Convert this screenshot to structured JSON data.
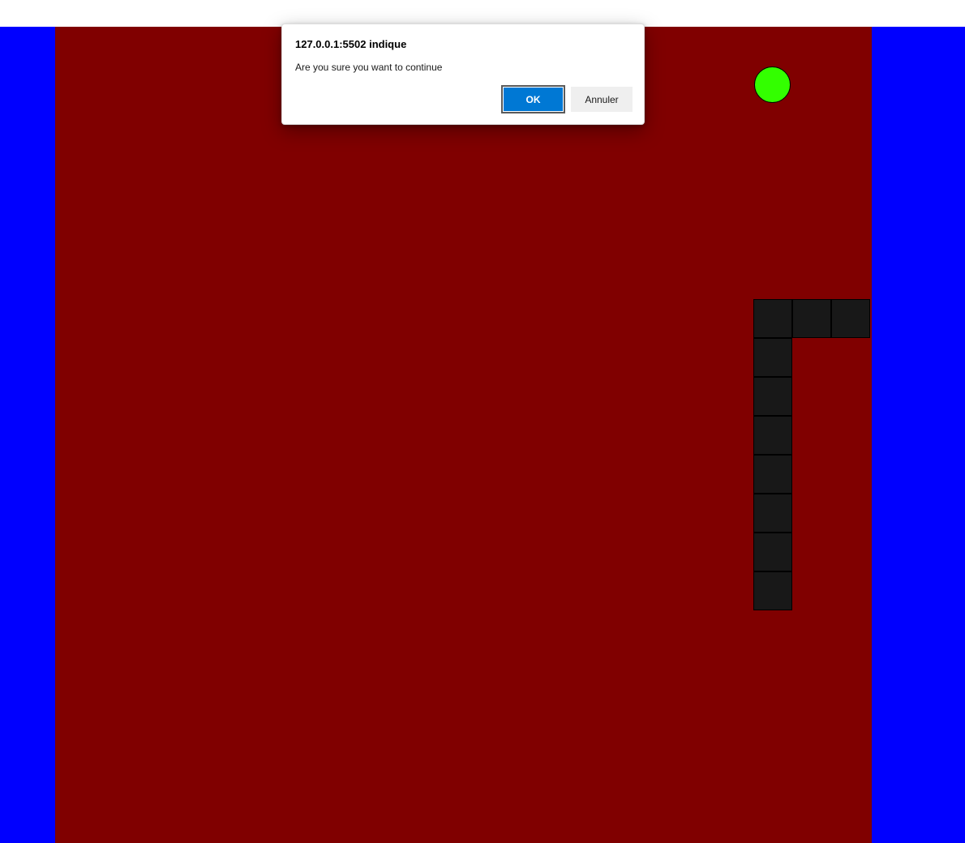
{
  "colors": {
    "page_background": "#0000ff",
    "board_background": "#800000",
    "snake": "#181818",
    "food": "#33ff00",
    "ok_button": "#0078d4"
  },
  "game": {
    "snake_segments": 10,
    "food_count": 1
  },
  "dialog": {
    "title": "127.0.0.1:5502 indique",
    "message": "Are you sure you want to continue",
    "ok_label": "OK",
    "cancel_label": "Annuler"
  }
}
